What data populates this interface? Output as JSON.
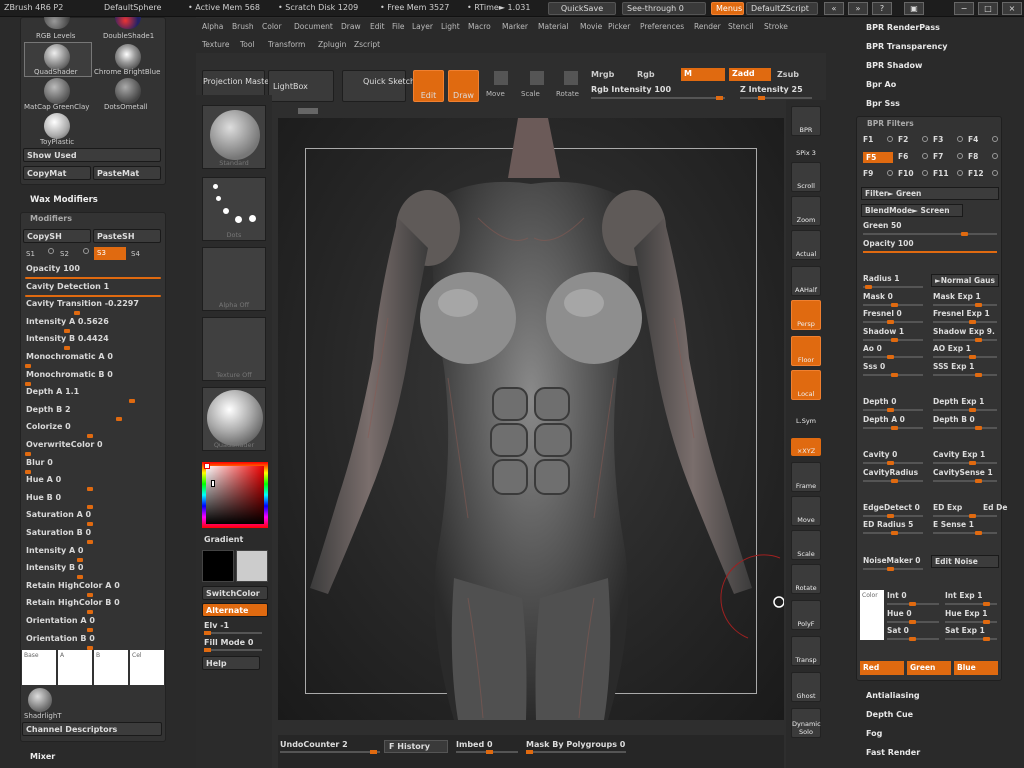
{
  "topbar": {
    "app": "ZBrush 4R6 P2",
    "doc": "DefaultSphere",
    "active_mem": "• Active Mem 568",
    "scratch": "• Scratch Disk 1209",
    "free_mem": "• Free Mem 3527",
    "rtime": "• RTime► 1.031",
    "quicksave": "QuickSave",
    "seethrough": "See-through  0",
    "menus": "Menus",
    "script": "DefaultZScript",
    "win_buttons": [
      "«",
      "»",
      "?",
      "▣",
      "−",
      "□",
      "×"
    ]
  },
  "menus": {
    "row1": [
      "Alpha",
      "Brush",
      "Color",
      "Document",
      "Draw",
      "Edit",
      "File",
      "Layer",
      "Light",
      "Macro",
      "Marker",
      "Material",
      "Movie",
      "Picker",
      "Preferences",
      "Render",
      "Stencil",
      "Stroke"
    ],
    "row2": [
      "Texture",
      "Tool",
      "Transform",
      "Zplugin",
      "Zscript"
    ]
  },
  "left": {
    "materials": [
      {
        "label": "RGB Levels"
      },
      {
        "label": "DoubleShade1"
      },
      {
        "label": "QuadShader"
      },
      {
        "label": "Chrome BrightBlue"
      },
      {
        "label": "MatCap GreenClay"
      },
      {
        "label": "DotsOmetall"
      },
      {
        "label": "ToyPlastic"
      }
    ],
    "show_used": "Show Used",
    "copymat": "CopyMat",
    "pastemat": "PasteMat",
    "wax_modifiers": "Wax Modifiers",
    "modifiers_title": "Modifiers",
    "copysh": "CopySH",
    "pastesh": "PasteSH",
    "s_buttons": [
      "S1",
      "S2",
      "S3",
      "S4"
    ],
    "sliders": [
      {
        "label": "Opacity 100",
        "value": 1.0
      },
      {
        "label": "Cavity Detection 1",
        "value": 1.0
      },
      {
        "label": "Cavity Transition -0.2297",
        "value": 0.38
      },
      {
        "label": "Intensity A 0.5626",
        "value": 0.3
      },
      {
        "label": "Intensity B 0.4424",
        "value": 0.3
      },
      {
        "label": "Monochromatic A 0",
        "value": 0.0
      },
      {
        "label": "Monochromatic B 0",
        "value": 0.0
      },
      {
        "label": "Depth A 1.1",
        "value": 0.8
      },
      {
        "label": "Depth B 2",
        "value": 0.7
      },
      {
        "label": "Colorize 0",
        "value": 0.48
      },
      {
        "label": "OverwriteColor 0",
        "value": 0.0
      },
      {
        "label": "Blur 0",
        "value": 0.0
      },
      {
        "label": "Hue A 0",
        "value": 0.48
      },
      {
        "label": "Hue B 0",
        "value": 0.48
      },
      {
        "label": "Saturation A 0",
        "value": 0.48
      },
      {
        "label": "Saturation B 0",
        "value": 0.48
      },
      {
        "label": "Intensity A 0",
        "value": 0.4
      },
      {
        "label": "Intensity B 0",
        "value": 0.4
      },
      {
        "label": "Retain HighColor A 0",
        "value": 0.48
      },
      {
        "label": "Retain HighColor B 0",
        "value": 0.48
      },
      {
        "label": "Orientation A 0",
        "value": 0.48
      },
      {
        "label": "Orientation B 0",
        "value": 0.48
      }
    ],
    "channels": [
      "Base",
      "A",
      "B",
      "Cel"
    ],
    "shadrlight": "ShadrlighT",
    "channel_descriptors": "Channel Descriptors",
    "mixer": "Mixer"
  },
  "toolcol": {
    "tiles": [
      {
        "label": "Standard"
      },
      {
        "label": "Dots"
      },
      {
        "label": "Alpha Off"
      },
      {
        "label": "Texture Off"
      },
      {
        "label": "QuadShader"
      }
    ],
    "gradient": "Gradient",
    "switchcolor": "SwitchColor",
    "alternate": "Alternate",
    "elv": "Elv -1",
    "fillmode": "Fill Mode 0",
    "help": "Help"
  },
  "topctrl": {
    "projection_master": "Projection Master",
    "lightbox": "LightBox",
    "quick_sketch": "Quick Sketch",
    "edit": "Edit",
    "draw": "Draw",
    "move": "Move",
    "scale": "Scale",
    "rotate": "Rotate",
    "mrgb": "Mrgb",
    "rgb": "Rgb",
    "m": "M",
    "zadd": "Zadd",
    "zsub": "Zsub",
    "rgb_intensity": "Rgb Intensity 100",
    "z_intensity": "Z Intensity 25"
  },
  "shelf": [
    {
      "label": "BPR"
    },
    {
      "label": "SPix 3"
    },
    {
      "label": "Scroll"
    },
    {
      "label": "Zoom"
    },
    {
      "label": "Actual"
    },
    {
      "label": "AAHalf"
    },
    {
      "label": "Persp"
    },
    {
      "label": "Floor"
    },
    {
      "label": "Local"
    },
    {
      "label": "L.Sym"
    },
    {
      "label": "×XYZ"
    },
    {
      "label": "Frame"
    },
    {
      "label": "Move"
    },
    {
      "label": "Scale"
    },
    {
      "label": "Rotate"
    },
    {
      "label": "PolyF"
    },
    {
      "label": "Transp"
    },
    {
      "label": "Ghost"
    },
    {
      "label": "Dynamic Solo"
    }
  ],
  "right": {
    "titles_top": [
      "BPR RenderPass",
      "BPR Transparency",
      "BPR Shadow",
      "Bpr Ao",
      "Bpr Sss"
    ],
    "filters_title": "BPR Filters",
    "f_buttons": [
      "F1",
      "F2",
      "F3",
      "F4",
      "F5",
      "F6",
      "F7",
      "F8",
      "F9",
      "F10",
      "F11",
      "F12"
    ],
    "filter": "Filter► Green",
    "blendmode": "BlendMode► Screen",
    "green": "Green 50",
    "opacity": "Opacity 100",
    "radius": "Radius 1",
    "normal_gauss": "►Normal Gaus",
    "pairs": [
      [
        "Mask 0",
        "Mask Exp 1"
      ],
      [
        "Fresnel 0",
        "Fresnel Exp 1"
      ],
      [
        "Shadow 1",
        "Shadow Exp 9."
      ],
      [
        "Ao 0",
        "AO Exp 1"
      ],
      [
        "Sss 0",
        "SSS Exp 1"
      ],
      [
        "Depth 0",
        "Depth Exp 1"
      ],
      [
        "Depth A 0",
        "Depth B 0"
      ],
      [
        "Cavity 0",
        "Cavity Exp 1"
      ],
      [
        "CavityRadius",
        "CavitySense 1"
      ],
      [
        "EdgeDetect 0",
        "ED Exp",
        "Ed De"
      ],
      [
        "ED Radius 5",
        "E Sense 1"
      ]
    ],
    "noisemaker": "NoiseMaker 0",
    "edit_noise": "Edit Noise",
    "color": "Color",
    "color_pairs": [
      [
        "Int 0",
        "Int Exp 1"
      ],
      [
        "Hue 0",
        "Hue Exp 1"
      ],
      [
        "Sat 0",
        "Sat Exp 1"
      ]
    ],
    "rgb_buttons": [
      "Red",
      "Green",
      "Blue"
    ],
    "titles_bottom": [
      "Antialiasing",
      "Depth Cue",
      "Fog",
      "Fast Render"
    ]
  },
  "bottom": {
    "undocounter": "UndoCounter 2",
    "history": "F History",
    "imbed": "Imbed 0",
    "mask_polygroups": "Mask By Polygroups 0"
  },
  "colors": {
    "accent": "#e06a10",
    "panel": "#2a2a2a"
  }
}
